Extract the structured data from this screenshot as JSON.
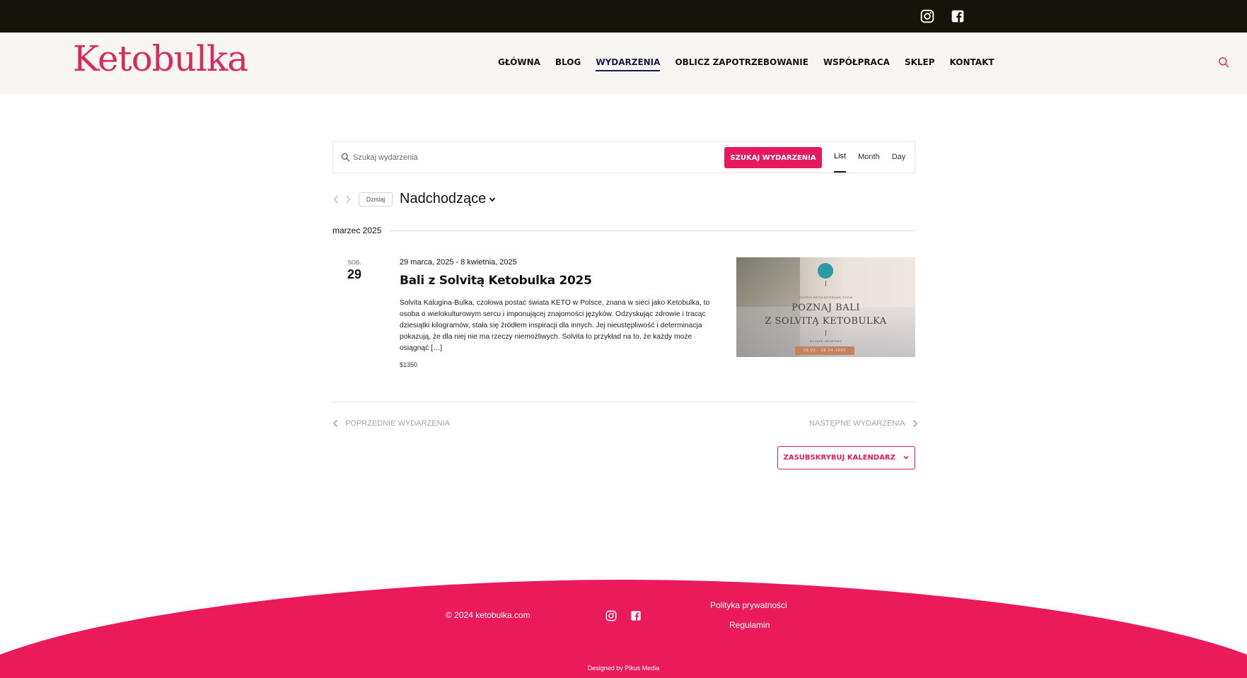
{
  "topbar": {
    "icons": [
      "instagram-icon",
      "facebook-icon"
    ]
  },
  "header": {
    "logo": "Ketobulka",
    "nav": [
      {
        "label": "GŁÓWNA",
        "active": false
      },
      {
        "label": "BLOG",
        "active": false
      },
      {
        "label": "WYDARZENIA",
        "active": true
      },
      {
        "label": "OBLICZ ZAPOTRZEBOWANIE",
        "active": false
      },
      {
        "label": "WSPÓŁPRACA",
        "active": false
      },
      {
        "label": "SKLEP",
        "active": false
      },
      {
        "label": "KONTAKT",
        "active": false
      }
    ]
  },
  "events_bar": {
    "search_placeholder": "Szukaj wydarzenia",
    "search_button": "SZUKAJ WYDARZENIA",
    "views": [
      "List",
      "Month",
      "Day"
    ],
    "active_view": "List"
  },
  "date_nav": {
    "today": "Dzisiaj",
    "range": "Nadchodzące"
  },
  "month_separator": "marzec 2025",
  "event": {
    "dow": "SOB.",
    "day": "29",
    "dates": "29 marca, 2025 - 8 kwietnia, 2025",
    "title": "Bali z Solvitą Ketobulka 2025",
    "description": "Solvita Kalugina-Bulka, czołowa postać świata KETO w Polsce, znana w sieci jako Ketobulka, to osoba o wielokulturowym sercu i imponującej znajomości języków. Odzyskując zdrowie i tracąc dziesiątki kilogramów, stała się źródłem inspiracji dla innych. Jej nieustępliwość i determinacja pokazują, że dla niej nie ma rzeczy niemożliwych. Solvita to przykład na to, że każdy może osiągnąć […]",
    "price": "$1350",
    "image": {
      "small_top": "ODKRYJ KETO-WYPRAWĘ ŻYCIA",
      "line1": "POZNAJ BALI",
      "line2": "Z SOLVITĄ KETOBULKA",
      "small_bottom": "WYJAZD GRUPOWY",
      "pill": "29.03 - 08.04.2025"
    }
  },
  "pager": {
    "prev": "POPRZEDNIE WYDARZENIA",
    "next": "NASTĘPNE WYDARZENIA"
  },
  "subscribe": "ZASUBSKRYBUJ KALENDARZ",
  "footer": {
    "copyright": "© 2024 ketobulka.com",
    "links": [
      "Polityka prywatności",
      "Regulamin"
    ],
    "designed_by": "Designed by Pikus Media",
    "color": "#eb1a5b"
  },
  "colors": {
    "accent": "#e5195f",
    "topbar": "#16140a",
    "header_bg": "#f7f6f3",
    "logo": "#d62b5e"
  }
}
